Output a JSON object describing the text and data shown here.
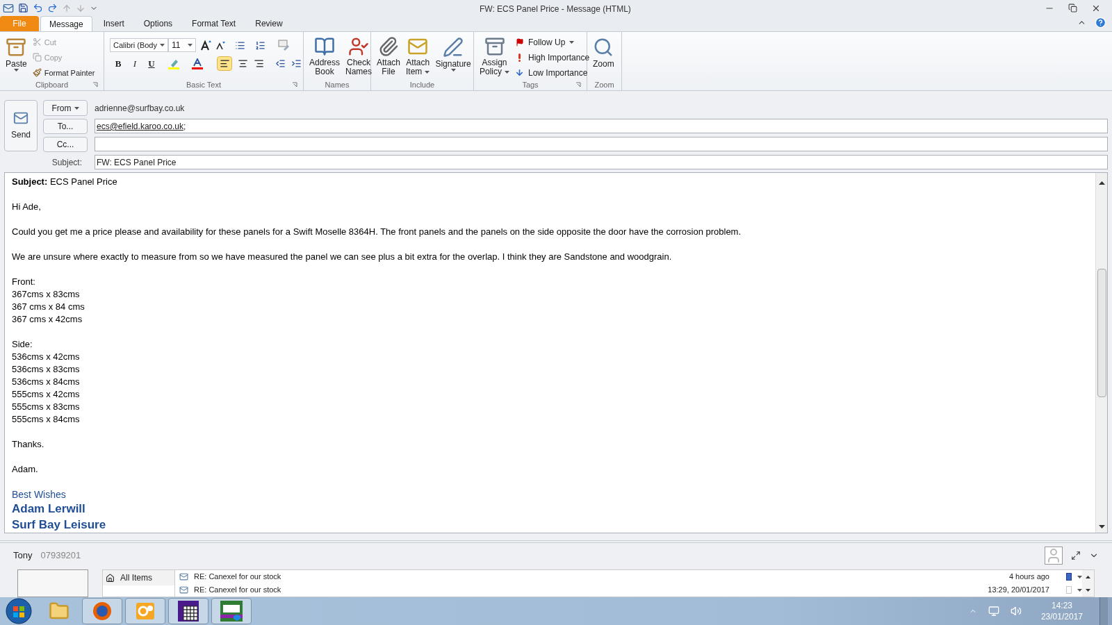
{
  "window": {
    "title": "FW: ECS Panel Price  -  Message (HTML)"
  },
  "tabs": [
    {
      "label": "File",
      "kind": "file",
      "selected": false
    },
    {
      "label": "Message",
      "kind": "tab",
      "selected": true
    },
    {
      "label": "Insert",
      "kind": "tab",
      "selected": false
    },
    {
      "label": "Options",
      "kind": "tab",
      "selected": false
    },
    {
      "label": "Format Text",
      "kind": "tab",
      "selected": false
    },
    {
      "label": "Review",
      "kind": "tab",
      "selected": false
    }
  ],
  "ribbon": {
    "clipboard": {
      "label": "Clipboard",
      "paste": "Paste",
      "cut": {
        "label": "Cut",
        "disabled": true
      },
      "copy": {
        "label": "Copy",
        "disabled": true
      },
      "format_painter": {
        "label": "Format Painter",
        "disabled": false
      }
    },
    "basic_text": {
      "label": "Basic Text",
      "font": "Calibri (Body",
      "size": "11",
      "bold": "B",
      "italic": "I",
      "underline": "U",
      "align_left_selected": true
    },
    "names": {
      "label": "Names",
      "items": [
        {
          "line1": "Address",
          "line2": "Book",
          "kind": "book"
        },
        {
          "line1": "Check",
          "line2": "Names",
          "kind": "check"
        }
      ]
    },
    "include": {
      "label": "Include",
      "items": [
        {
          "line1": "Attach",
          "line2": "File",
          "kind": "clip"
        },
        {
          "line1": "Attach",
          "line2": "Item",
          "kind": "envelope"
        },
        {
          "line1": "Signature",
          "kind": "pen"
        }
      ]
    },
    "tags": {
      "label": "Tags",
      "policy": {
        "line1": "Assign",
        "line2": "Policy"
      },
      "items": [
        {
          "label": "Follow Up",
          "kind": "flag"
        },
        {
          "label": "High Importance",
          "kind": "high"
        },
        {
          "label": "Low Importance",
          "kind": "low"
        }
      ]
    },
    "zoom": {
      "label": "Zoom",
      "button": "Zoom"
    }
  },
  "header": {
    "send": "Send",
    "from_button": "From",
    "from_value": "adrienne@surfbay.co.uk",
    "to_button": "To...",
    "to_value": "ecs@efield.karoo.co.uk",
    "to_separator": ";",
    "cc_button": "Cc...",
    "subject_label": "Subject:",
    "subject_value": "FW: ECS Panel Price"
  },
  "body": {
    "paragraphs": [
      [
        "**Subject:** ECS Panel Price"
      ],
      [
        "Hi Ade,"
      ],
      [
        "Could you get me a price please and availability for these panels for a Swift Moselle 8364H.  The front panels and the panels on the side opposite the door have the corrosion problem."
      ],
      [
        "We are unsure where exactly to measure from so we have measured the panel we can see plus a bit extra for the overlap.  I think they are Sandstone and woodgrain."
      ],
      [
        "Front:",
        "367cms x 83cms",
        "367 cms x 84 cms",
        "367 cms x 42cms"
      ],
      [
        "Side:",
        "536cms x 42cms",
        "536cms x 83cms",
        "536cms x 84cms",
        "555cms x 42cms",
        "555cms x 83cms",
        "555cms x 84cms"
      ],
      [
        "Thanks."
      ],
      [
        "Adam."
      ]
    ],
    "signature": {
      "greeting": "Best Wishes",
      "name": "Adam Lerwill",
      "company": "Surf Bay Leisure"
    }
  },
  "people_pane": {
    "name": "Tony",
    "phone": "07939201",
    "nav": [
      {
        "label": "All Items",
        "selected": true
      }
    ],
    "messages": [
      {
        "subject": "RE: Canexel for our stock",
        "time": "4 hours ago",
        "flagged": true
      },
      {
        "subject": "RE: Canexel for our stock",
        "time": "13:29, 20/01/2017",
        "flagged": false
      }
    ]
  },
  "taskbar": {
    "apps": [
      {
        "kind": "folder",
        "active": false
      },
      {
        "kind": "firefox",
        "active": true
      },
      {
        "kind": "outlook",
        "active": true
      },
      {
        "kind": "grid",
        "active": true
      },
      {
        "kind": "sage",
        "active": true
      }
    ],
    "time": "14:23",
    "date": "23/01/2017"
  }
}
